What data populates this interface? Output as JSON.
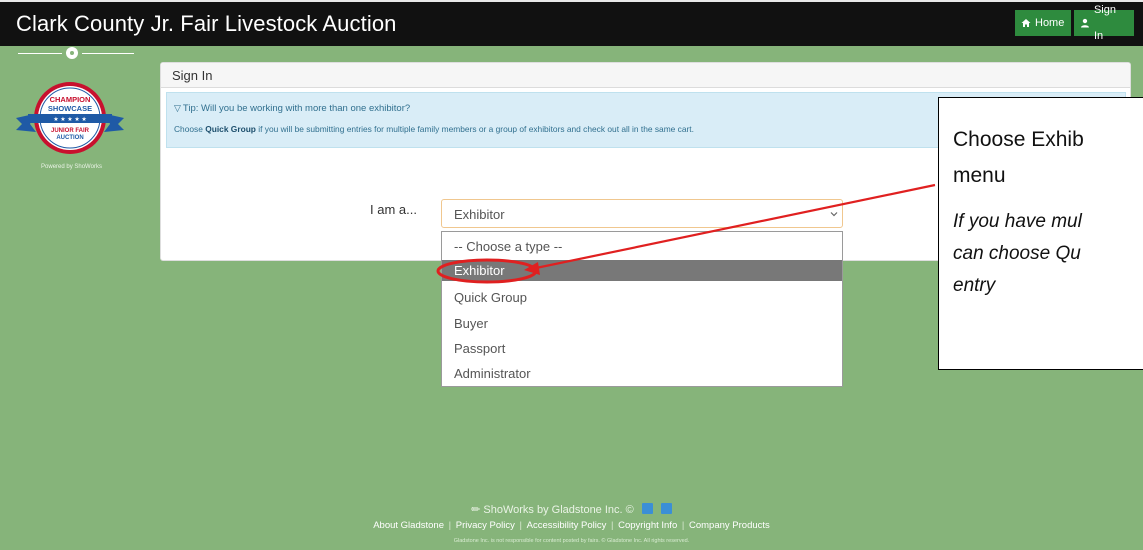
{
  "header": {
    "app_title": "Clark County Jr. Fair Livestock Auction",
    "home_label": "Home",
    "signin_label": "Sign In"
  },
  "sidebar": {
    "logo_lines": [
      "CHAMPION",
      "SHOWCASE",
      "JUNIOR FAIR",
      "AUCTION"
    ],
    "powered_by": "Powered by ShoWorks"
  },
  "card": {
    "title": "Sign In",
    "tip_title": "Tip: Will you be working with more than one exhibitor?",
    "tip_text_prefix": "Choose ",
    "tip_text_bold": "Quick Group",
    "tip_text_suffix": " if you will be submitting entries for multiple family members or a group of exhibitors and check out all in the same cart.",
    "role_label": "I am a...",
    "role_value": "Exhibitor",
    "role_options": [
      "-- Choose a type --",
      "Exhibitor",
      "Quick Group",
      "Buyer",
      "Passport",
      "Administrator"
    ],
    "role_selected_index": 1
  },
  "callout": {
    "line1": "Choose Exhib",
    "line2": "menu",
    "note1": "If you have mul",
    "note2": "can choose Qu",
    "note3": "entry"
  },
  "footer": {
    "brand": "ShoWorks by Gladstone Inc. ©",
    "links": [
      "About Gladstone",
      "Privacy Policy",
      "Accessibility Policy",
      "Copyright Info",
      "Company Products"
    ],
    "legal": "Gladstone Inc. is not responsible for content posted by fairs. © Gladstone Inc. All rights reserved."
  },
  "colors": {
    "background": "#86b47a",
    "topbar": "#111111",
    "nav_button": "#2e8b3e",
    "tip_bg": "#d9edf7",
    "selected_option": "#787878",
    "annotation": "#e02020"
  }
}
